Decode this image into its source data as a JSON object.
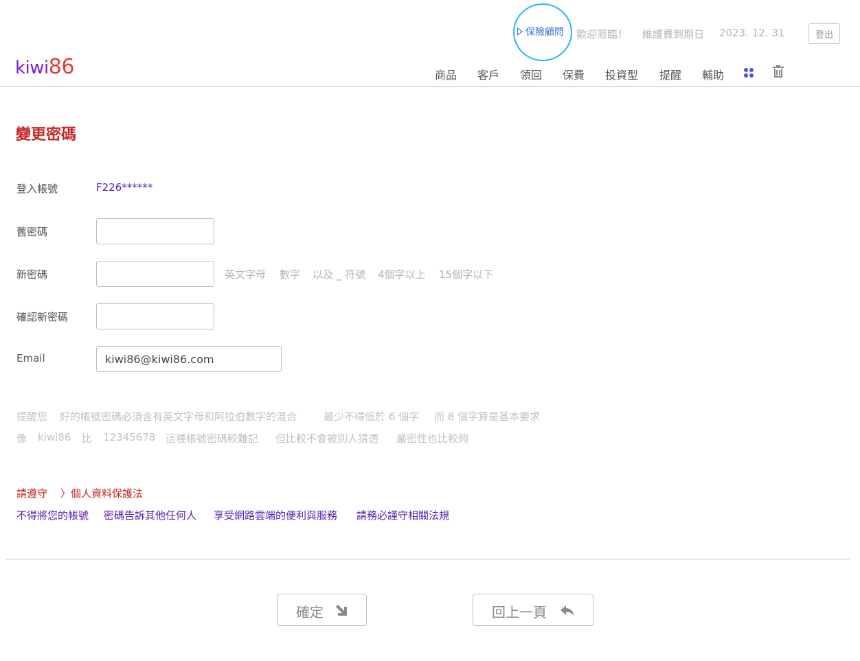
{
  "header": {
    "logo": {
      "kiwi": "kiwi",
      "num": "86"
    },
    "advisor_label": "保險顧問",
    "welcome": "歡迎蒞臨！",
    "maintenance_label": "維護費到期日",
    "maintenance_date": "2023. 12. 31",
    "logout_label": "登出",
    "nav": [
      "商品",
      "客戶",
      "領回",
      "保費",
      "投資型",
      "提醒",
      "輔助"
    ]
  },
  "page": {
    "title": "變更密碼"
  },
  "form": {
    "account_label": "登入帳號",
    "account_value": "F226******",
    "old_password_label": "舊密碼",
    "new_password_label": "新密碼",
    "new_password_hints": [
      "英文字母",
      "數字",
      "以及 _ 符號",
      "4個字以上",
      "15個字以下"
    ],
    "confirm_password_label": "確認新密碼",
    "email_label": "Email",
    "email_value": "kiwi86@kiwi86.com"
  },
  "tips": {
    "line1": [
      "提醒您",
      "好的帳號密碼必須含有英文字母和阿拉伯數字的混合",
      "最少不得低於 6 個字",
      "而 8 個字算是基本要求"
    ],
    "line2": [
      "像",
      "kiwi86",
      "比",
      "12345678",
      "這種帳號密碼較難記",
      "但比較不會被別人猜透",
      "嚴密性也比較夠"
    ]
  },
  "law": {
    "red": [
      "請遵守",
      "〉個人資料保護法"
    ],
    "purple": [
      "不得將您的帳號",
      "密碼告訴其他任何人",
      "享受網路雲端的便利與服務",
      "請務必謹守相關法規"
    ]
  },
  "buttons": {
    "confirm": "確定",
    "back": "回上一頁"
  },
  "colors": {
    "brand_purple": "#7b1fd6",
    "brand_red": "#e53935",
    "title_red": "#c62828",
    "advisor_blue": "#29b6f6",
    "apps_blue": "#4a55e0"
  }
}
